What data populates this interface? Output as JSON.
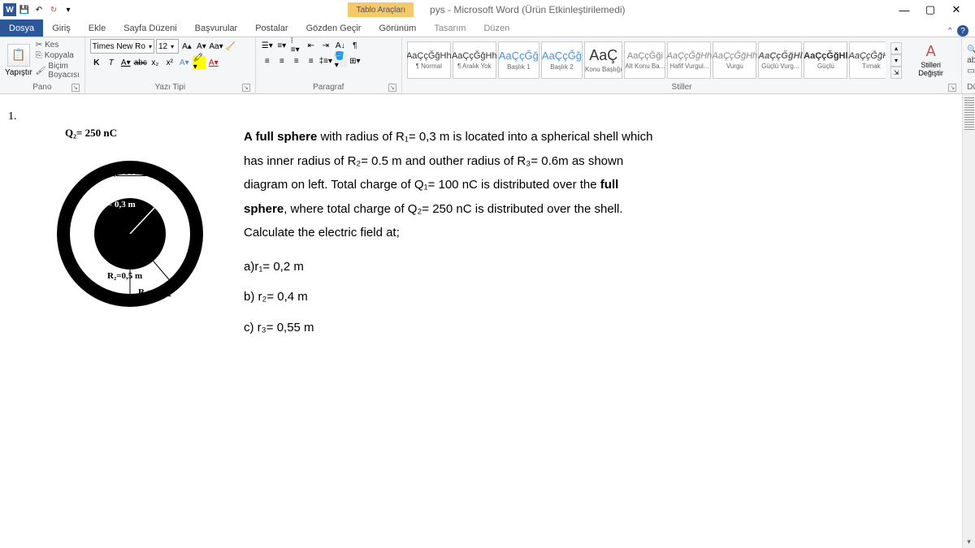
{
  "titlebar": {
    "tablo_araclari": "Tablo Araçları",
    "doc_title": "pys - Microsoft Word (Ürün Etkinleştirilemedi)"
  },
  "tabs": {
    "dosya": "Dosya",
    "giris": "Giriş",
    "ekle": "Ekle",
    "sayfa_duzeni": "Sayfa Düzeni",
    "basvurular": "Başvurular",
    "postalar": "Postalar",
    "gozden_gecir": "Gözden Geçir",
    "gorunum": "Görünüm",
    "tasarim": "Tasarım",
    "duzen": "Düzen"
  },
  "clipboard": {
    "yapistir": "Yapıştır",
    "kes": "Kes",
    "kopyala": "Kopyala",
    "bicim": "Biçim Boyacısı",
    "label": "Pano"
  },
  "font": {
    "name": "Times New Ro",
    "size": "12",
    "label": "Yazı Tipi"
  },
  "paragraph": {
    "label": "Paragraf"
  },
  "styles": {
    "label": "Stiller",
    "items": [
      {
        "sample": "AaÇçĞğHh",
        "name": "¶ Normal"
      },
      {
        "sample": "AaÇçĞğHh",
        "name": "¶ Aralık Yok"
      },
      {
        "sample": "AaÇçĞğ",
        "name": "Başlık 1"
      },
      {
        "sample": "AaÇçĞğ",
        "name": "Başlık 2"
      },
      {
        "sample": "AaÇ",
        "name": "Konu Başlığı"
      },
      {
        "sample": "AaÇçĞği",
        "name": "Alt Konu Ba..."
      },
      {
        "sample": "AaÇçĞğHh",
        "name": "Hafif Vurgul..."
      },
      {
        "sample": "AaÇçĞğHh",
        "name": "Vurgu"
      },
      {
        "sample": "AaÇçĞğHl",
        "name": "Güçlü Vurg..."
      },
      {
        "sample": "AaÇçĞğHl",
        "name": "Güçlü"
      },
      {
        "sample": "AaÇçĞğHh",
        "name": "Tırnak"
      }
    ],
    "change": "Stilleri Değiştir"
  },
  "editing": {
    "bul": "Bul",
    "degistir": "Değiştir",
    "sec": "Seç",
    "label": "Düzenleme"
  },
  "document": {
    "list_marker": "1.",
    "diagram": {
      "q2_label": "Q₂= 250 nC",
      "q1_label": "Q₁= 100 nC",
      "r1_label": "R₁ = 0,3 m",
      "r2_label": "R₂=0,5 m",
      "r3_label": "R₃=0,6m"
    },
    "problem": {
      "line1a": "A full sphere",
      "line1b": " with radius of R₁= 0,3 m is located into a spherical shell which",
      "line2": "has inner radius of R₂= 0.5 m and outher radius of R₃= 0.6m  as shown",
      "line3a": "diagram on left. Total charge of Q₁= 100 nC is distributed over the ",
      "line3b": "full",
      "line4a": "sphere",
      "line4b": ", where total charge of Q₂= 250 nC is distributed over the shell.",
      "line5": "Calculate the electric field at;",
      "a": "a)r₁= 0,2 m",
      "b": "b) r₂= 0,4 m",
      "c": "c) r₃= 0,55 m"
    }
  }
}
